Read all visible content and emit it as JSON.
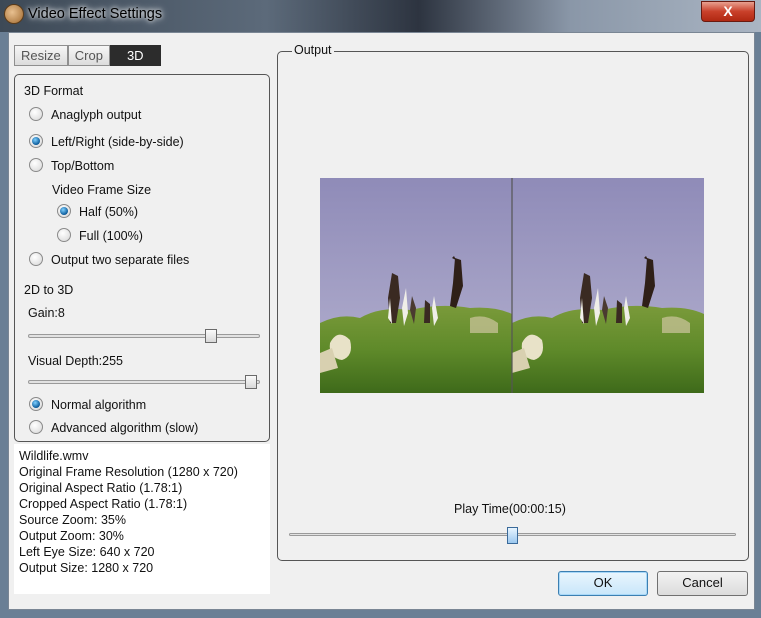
{
  "window": {
    "title": "Video Effect Settings",
    "close_label": "X"
  },
  "tabs": [
    {
      "label": "Resize"
    },
    {
      "label": "Crop"
    },
    {
      "label": "3D",
      "active": true
    }
  ],
  "format": {
    "heading": "3D Format",
    "anaglyph": "Anaglyph output",
    "left_right": "Left/Right (side-by-side)",
    "top_bottom": "Top/Bottom",
    "frame_size_heading": "Video Frame Size",
    "half": "Half (50%)",
    "full": "Full (100%)",
    "separate_files": "Output two separate files",
    "selected_output": "Left/Right (side-by-side)",
    "selected_frame_size": "Half (50%)"
  },
  "conversion": {
    "heading": "2D to 3D",
    "gain_label": "Gain:8",
    "gain_value": 8,
    "depth_label": "Visual Depth:255",
    "depth_value": 255,
    "normal_algorithm": "Normal algorithm",
    "advanced_algorithm": "Advanced algorithm (slow)",
    "selected_algorithm": "Normal algorithm"
  },
  "info": [
    "Wildlife.wmv",
    "Original Frame Resolution  (1280 x 720)",
    "Original Aspect Ratio (1.78:1)",
    "Cropped Aspect Ratio (1.78:1)",
    "Source Zoom:  35%",
    "Output Zoom:  30%",
    "Left Eye Size:  640 x 720",
    "Output Size:  1280 x 720"
  ],
  "output": {
    "legend": "Output",
    "play_time_label": "Play Time(00:00:15)",
    "play_position_fraction": 0.5
  },
  "buttons": {
    "ok": "OK",
    "cancel": "Cancel"
  },
  "colors": {
    "accent": "#0a5a9a",
    "close": "#c9402a"
  }
}
